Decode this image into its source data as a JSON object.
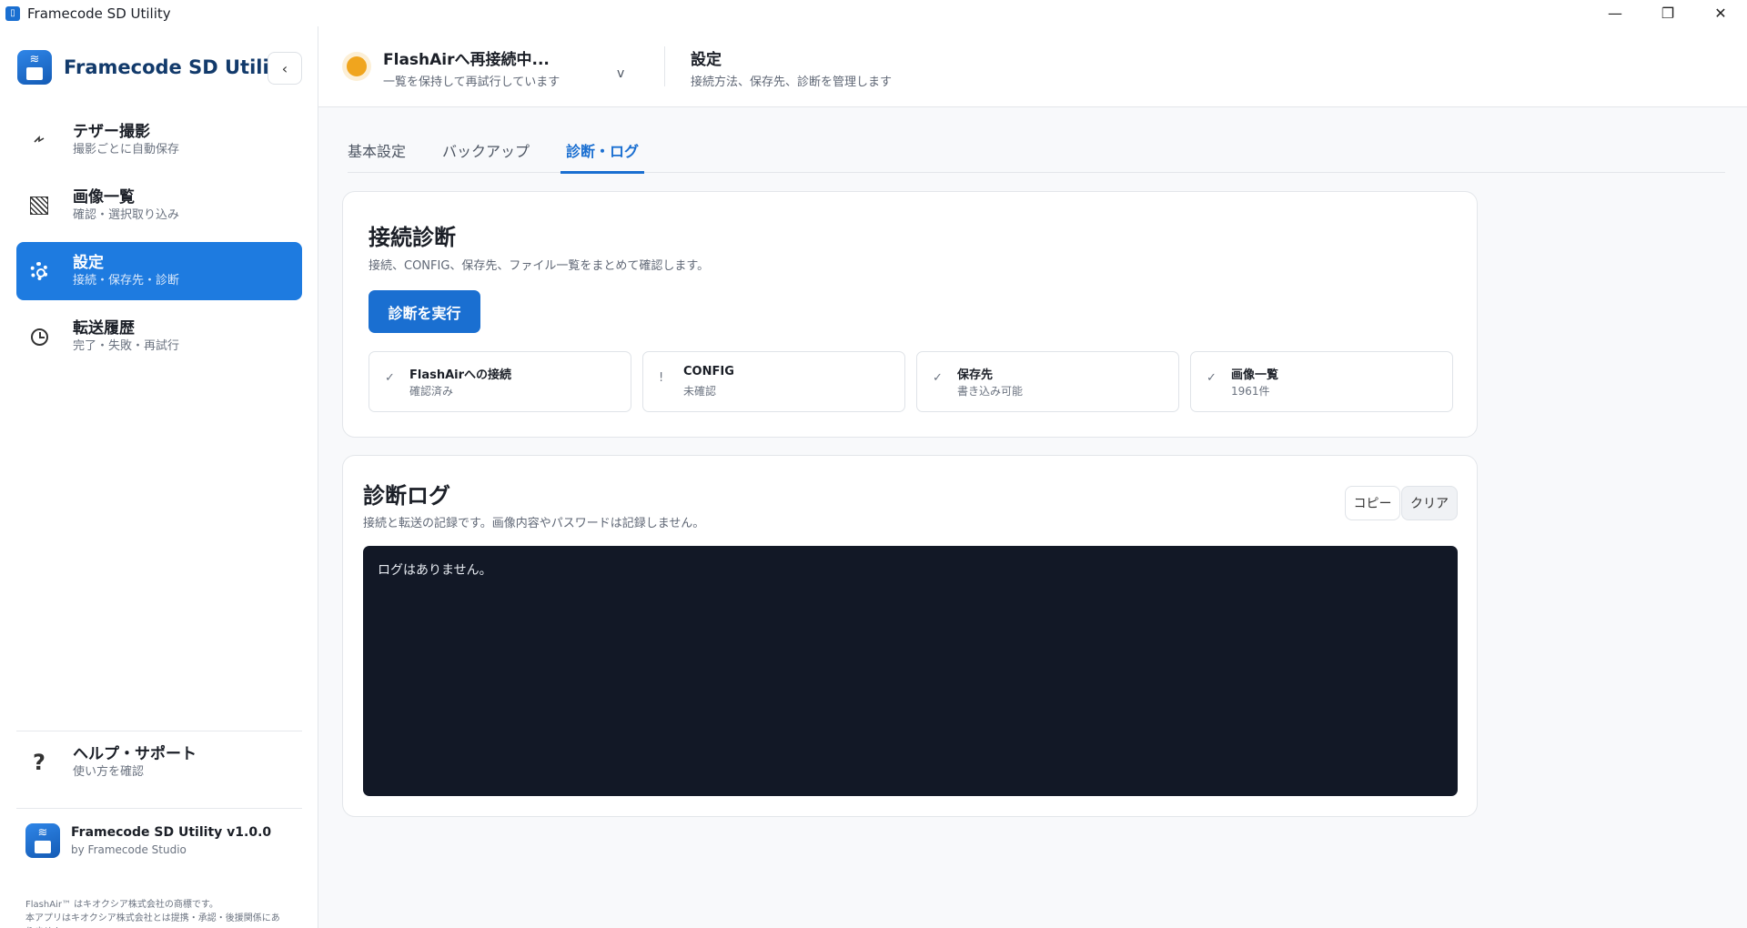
{
  "window": {
    "title": "Framecode SD Utility",
    "controls": {
      "minimize": "—",
      "restore": "❐",
      "close": "✕"
    }
  },
  "sidebar": {
    "brand": "Framecode SD Utility",
    "collapse_glyph": "‹",
    "items": [
      {
        "label": "テザー撮影",
        "sub": "撮影ごとに自動保存",
        "icon": "bolt-icon",
        "active": false
      },
      {
        "label": "画像一覧",
        "sub": "確認・選択取り込み",
        "icon": "image-grid-icon",
        "active": false
      },
      {
        "label": "設定",
        "sub": "接続・保存先・診断",
        "icon": "gear-icon",
        "active": true
      },
      {
        "label": "転送履歴",
        "sub": "完了・失敗・再試行",
        "icon": "clock-icon",
        "active": false
      }
    ],
    "help": {
      "label": "ヘルプ・サポート",
      "sub": "使い方を確認",
      "glyph": "?"
    },
    "footer": {
      "version": "Framecode SD Utility v1.0.0",
      "by": "by Framecode Studio",
      "legal_1": "FlashAir™ はキオクシア株式会社の商標です。",
      "legal_2": "本アプリはキオクシア株式会社とは提携・承認・後援関係にありません。"
    }
  },
  "header": {
    "status_title": "FlashAirへ再接続中...",
    "status_sub": "一覧を保持して再試行しています",
    "status_chevron": "v",
    "page_title": "設定",
    "page_sub": "接続方法、保存先、診断を管理します"
  },
  "tabs": [
    {
      "label": "基本設定",
      "active": false
    },
    {
      "label": "バックアップ",
      "active": false
    },
    {
      "label": "診断・ログ",
      "active": true
    }
  ],
  "diagnostics": {
    "title": "接続診断",
    "desc": "接続、CONFIG、保存先、ファイル一覧をまとめて確認します。",
    "run_button": "診断を実行",
    "checks": [
      {
        "mark": "✓",
        "label": "FlashAirへの接続",
        "value": "確認済み"
      },
      {
        "mark": "!",
        "label": "CONFIG",
        "value": "未確認"
      },
      {
        "mark": "✓",
        "label": "保存先",
        "value": "書き込み可能"
      },
      {
        "mark": "✓",
        "label": "画像一覧",
        "value": "1961件"
      }
    ]
  },
  "log": {
    "title": "診断ログ",
    "desc": "接続と転送の記録です。画像内容やパスワードは記録しません。",
    "copy_button": "コピー",
    "clear_button": "クリア",
    "empty_text": "ログはありません。"
  }
}
